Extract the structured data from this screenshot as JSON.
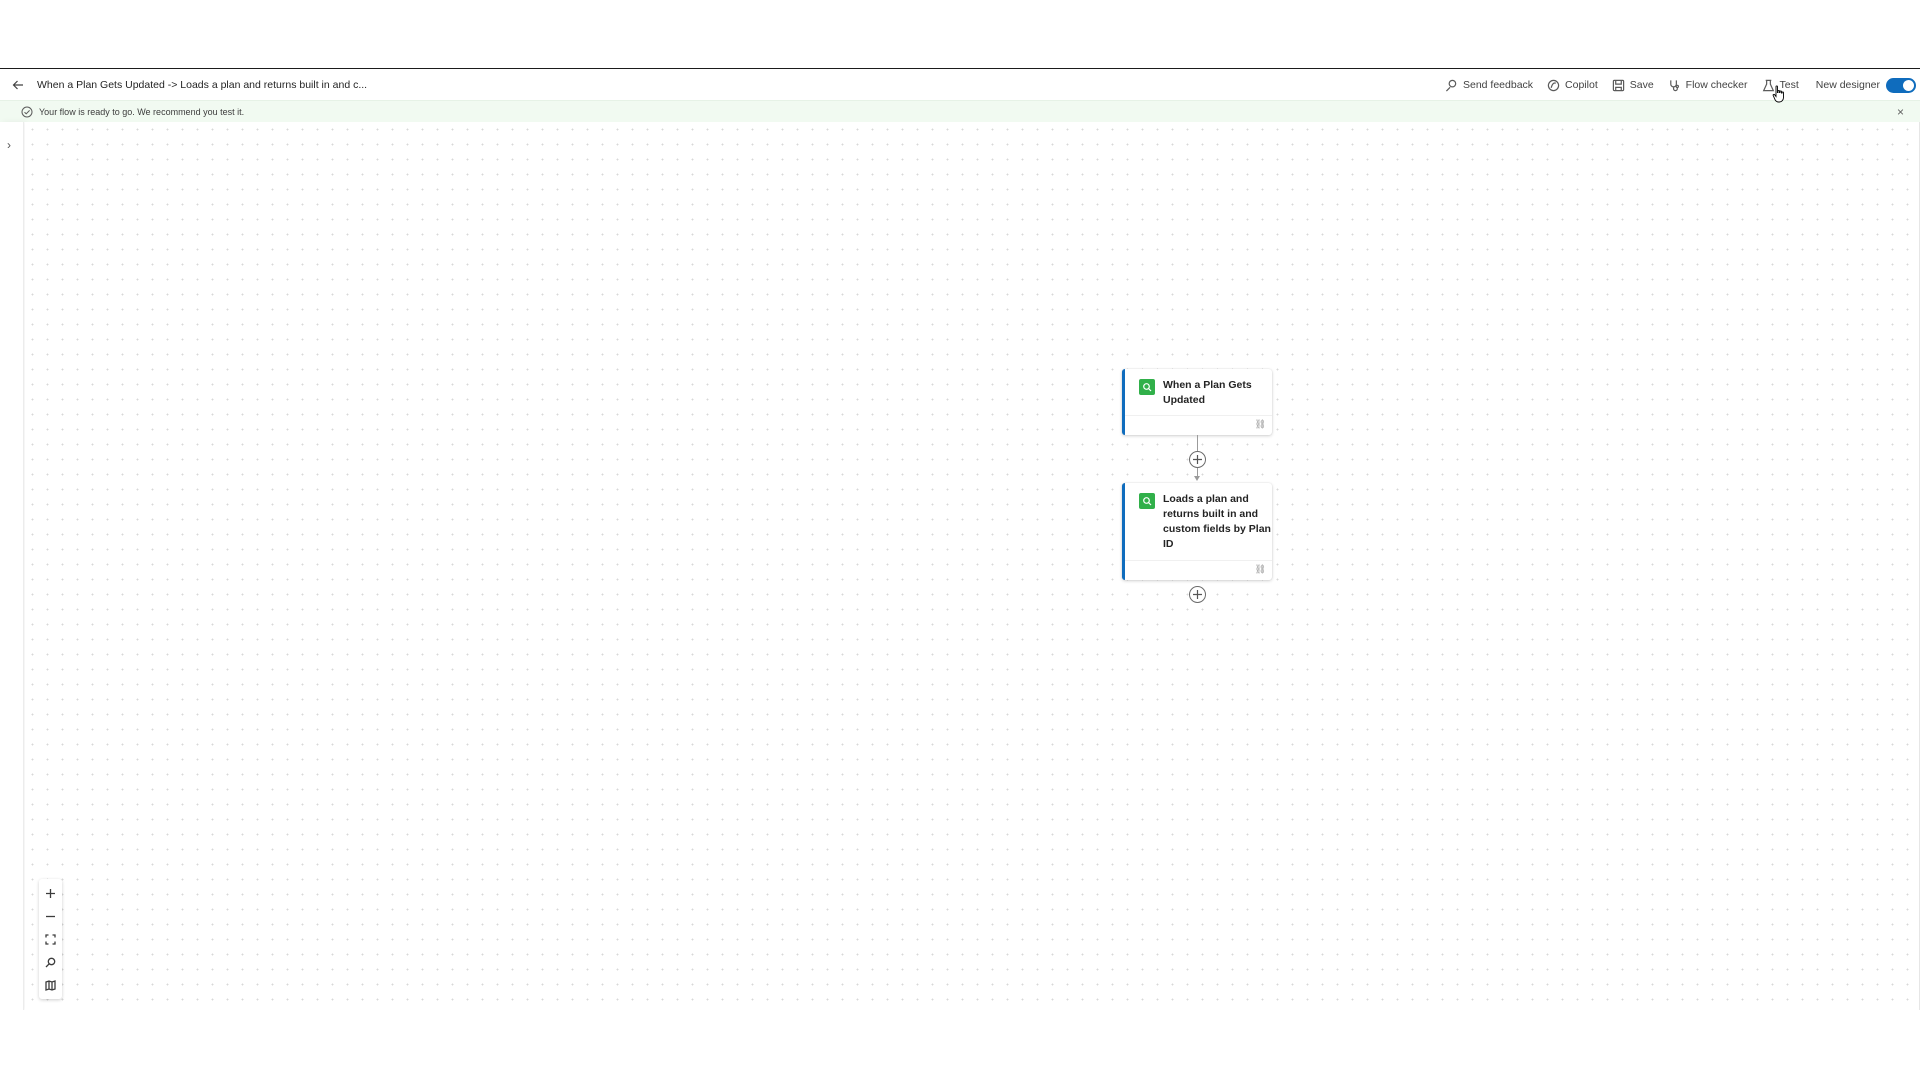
{
  "header": {
    "back_label": "←",
    "flow_title": "When a Plan Gets Updated -> Loads a plan and returns built in and c...",
    "actions": {
      "send_feedback": "Send feedback",
      "copilot": "Copilot",
      "save": "Save",
      "flow_checker": "Flow checker",
      "test": "Test"
    },
    "new_designer_label": "New designer",
    "new_designer_enabled": true
  },
  "notice": {
    "text": "Your flow is ready to go. We recommend you test it.",
    "close_label": "×",
    "color": "#f1faf1"
  },
  "sidebar": {
    "expand_label": "›"
  },
  "flow": {
    "trigger": {
      "title": "When a Plan Gets Updated",
      "icon": "planner-connector-icon",
      "link_icon": "link-icon"
    },
    "action": {
      "title": "Loads a plan and returns built in and custom fields by Plan ID",
      "icon": "planner-connector-icon",
      "link_icon": "link-icon"
    },
    "accent_color": "#0f6cbd",
    "connector_color": "#31b04a"
  },
  "zoom_controls": {
    "zoom_in": "zoom-in-icon",
    "zoom_out": "zoom-out-icon",
    "fit_view": "fit-view-icon",
    "search": "search-icon",
    "minimap": "minimap-icon"
  }
}
